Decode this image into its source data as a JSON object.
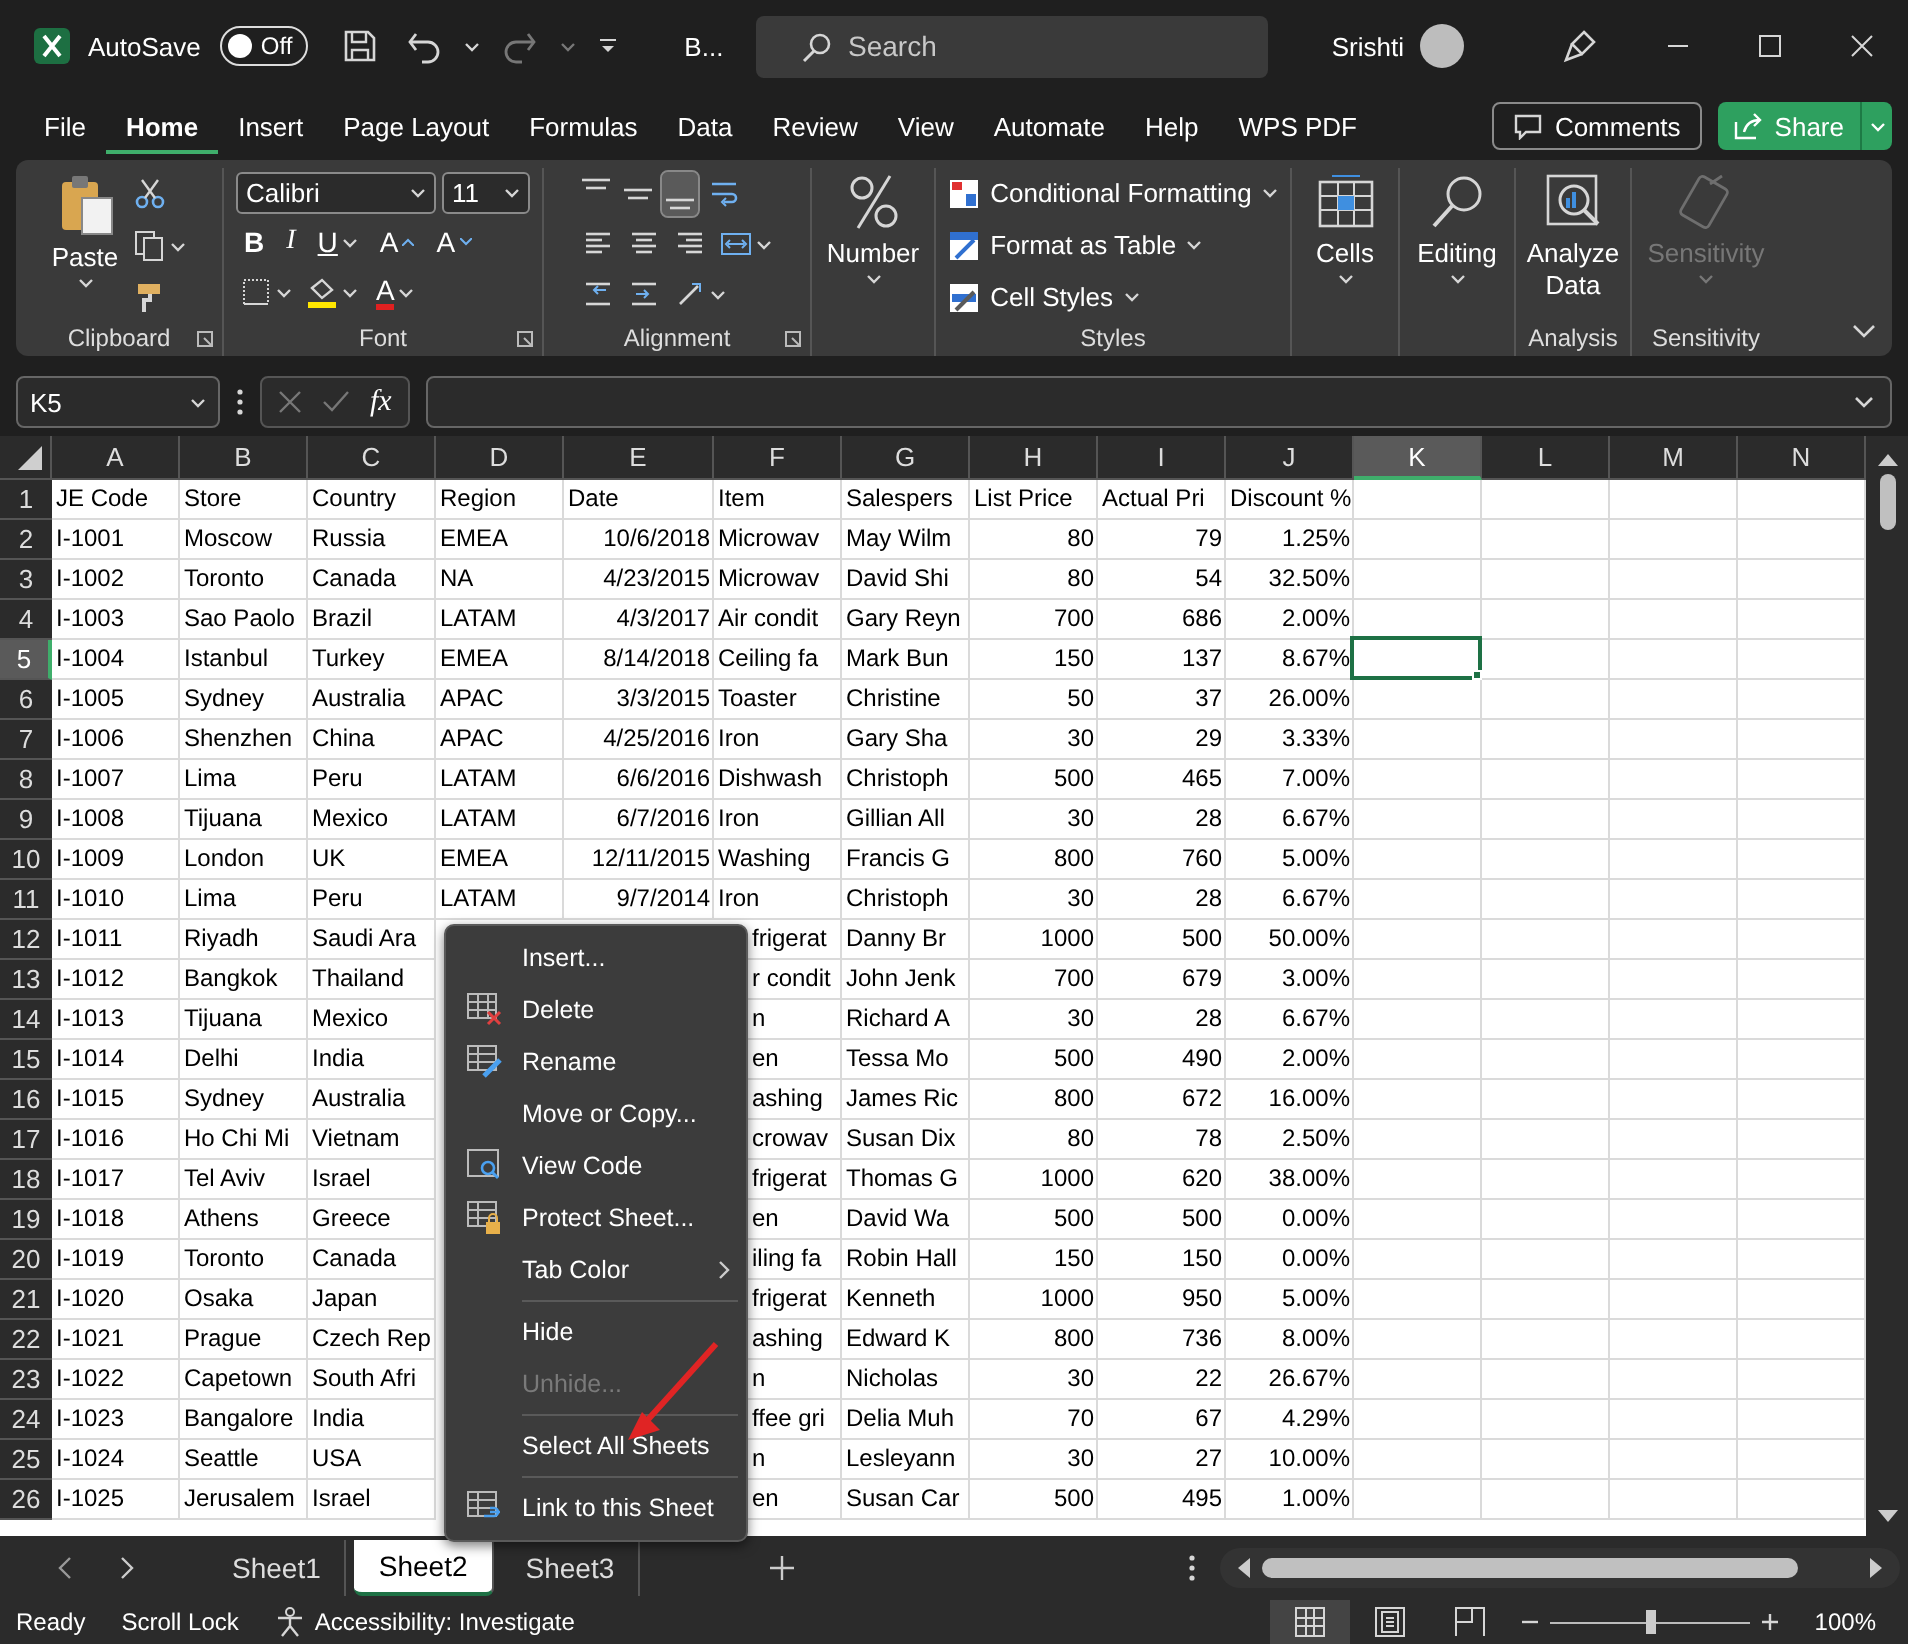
{
  "title_bar": {
    "autosave_label": "AutoSave",
    "autosave": {
      "on": false,
      "label": "Off"
    },
    "document_title": "B...",
    "search": {
      "placeholder": "Search"
    },
    "user": "Srishti"
  },
  "menu_tabs": [
    {
      "label": "File",
      "selected": false
    },
    {
      "label": "Home",
      "selected": true
    },
    {
      "label": "Insert",
      "selected": false
    },
    {
      "label": "Page Layout",
      "selected": false
    },
    {
      "label": "Formulas",
      "selected": false
    },
    {
      "label": "Data",
      "selected": false
    },
    {
      "label": "Review",
      "selected": false
    },
    {
      "label": "View",
      "selected": false
    },
    {
      "label": "Automate",
      "selected": false
    },
    {
      "label": "Help",
      "selected": false
    },
    {
      "label": "WPS PDF",
      "selected": false
    }
  ],
  "comments_button": "Comments",
  "share_button": "Share",
  "ribbon": {
    "groups": [
      {
        "kind": "clipboard",
        "label": "Clipboard",
        "button": "Paste",
        "launcher": true
      },
      {
        "kind": "font",
        "label": "Font",
        "font_name": "Calibri",
        "font_size": "11",
        "format_buttons": [
          "B",
          "I",
          "U"
        ],
        "size_buttons": [
          "A",
          "A"
        ],
        "font_color_button": "A",
        "launcher": true
      },
      {
        "kind": "alignment",
        "label": "Alignment",
        "launcher": true
      },
      {
        "kind": "number",
        "button": "Number"
      },
      {
        "kind": "styles",
        "label": "Styles",
        "buttons": [
          "Conditional Formatting",
          "Format as Table",
          "Cell Styles"
        ]
      },
      {
        "kind": "cells",
        "button": "Cells"
      },
      {
        "kind": "editing",
        "button": "Editing"
      },
      {
        "kind": "analysis",
        "label": "Analysis",
        "button": "Analyze Data"
      },
      {
        "kind": "sensitivity",
        "label": "Sensitivity",
        "button": "Sensitivity",
        "disabled": true
      }
    ]
  },
  "formula_bar": {
    "name_box": "K5",
    "function_button": "fx"
  },
  "sheet": {
    "columns": [
      {
        "label": "A",
        "kind": "text",
        "selected": false
      },
      {
        "label": "B",
        "kind": "text",
        "selected": false
      },
      {
        "label": "C",
        "kind": "text",
        "selected": false
      },
      {
        "label": "D",
        "kind": "text",
        "selected": false
      },
      {
        "label": "E",
        "kind": "number",
        "selected": false
      },
      {
        "label": "F",
        "kind": "text",
        "selected": false
      },
      {
        "label": "G",
        "kind": "text",
        "selected": false
      },
      {
        "label": "H",
        "kind": "number",
        "selected": false
      },
      {
        "label": "I",
        "kind": "number",
        "selected": false
      },
      {
        "label": "J",
        "kind": "number",
        "selected": false
      },
      {
        "label": "K",
        "kind": "text",
        "selected": true
      },
      {
        "label": "L",
        "kind": "text",
        "selected": false
      },
      {
        "label": "M",
        "kind": "text",
        "selected": false
      },
      {
        "label": "N",
        "kind": "text",
        "selected": false
      }
    ],
    "rows": [
      {
        "number": "1",
        "kind": "header",
        "selected": false,
        "cells": [
          "JE Code",
          "Store",
          "Country",
          "Region",
          "Date",
          "Item",
          "Salespers",
          "List Price",
          "Actual Pri",
          "Discount %"
        ]
      },
      {
        "number": "2",
        "kind": "data",
        "selected": false,
        "cells": [
          "I-1001",
          "Moscow",
          "Russia",
          "EMEA",
          "10/6/2018",
          "Microwav",
          "May Wilm",
          "80",
          "79",
          "1.25%"
        ]
      },
      {
        "number": "3",
        "kind": "data",
        "selected": false,
        "cells": [
          "I-1002",
          "Toronto",
          "Canada",
          "NA",
          "4/23/2015",
          "Microwav",
          "David Shi",
          "80",
          "54",
          "32.50%"
        ]
      },
      {
        "number": "4",
        "kind": "data",
        "selected": false,
        "cells": [
          "I-1003",
          "Sao Paolo",
          "Brazil",
          "LATAM",
          "4/3/2017",
          "Air condit",
          "Gary Reyn",
          "700",
          "686",
          "2.00%"
        ]
      },
      {
        "number": "5",
        "kind": "data",
        "selected": true,
        "cells": [
          "I-1004",
          "Istanbul",
          "Turkey",
          "EMEA",
          "8/14/2018",
          "Ceiling fa",
          "Mark Bun",
          "150",
          "137",
          "8.67%"
        ]
      },
      {
        "number": "6",
        "kind": "data",
        "selected": false,
        "cells": [
          "I-1005",
          "Sydney",
          "Australia",
          "APAC",
          "3/3/2015",
          "Toaster",
          "Christine",
          "50",
          "37",
          "26.00%"
        ]
      },
      {
        "number": "7",
        "kind": "data",
        "selected": false,
        "cells": [
          "I-1006",
          "Shenzhen",
          "China",
          "APAC",
          "4/25/2016",
          "Iron",
          "Gary Sha",
          "30",
          "29",
          "3.33%"
        ]
      },
      {
        "number": "8",
        "kind": "data",
        "selected": false,
        "cells": [
          "I-1007",
          "Lima",
          "Peru",
          "LATAM",
          "6/6/2016",
          "Dishwash",
          "Christoph",
          "500",
          "465",
          "7.00%"
        ]
      },
      {
        "number": "9",
        "kind": "data",
        "selected": false,
        "cells": [
          "I-1008",
          "Tijuana",
          "Mexico",
          "LATAM",
          "6/7/2016",
          "Iron",
          "Gillian All",
          "30",
          "28",
          "6.67%"
        ]
      },
      {
        "number": "10",
        "kind": "data",
        "selected": false,
        "cells": [
          "I-1009",
          "London",
          "UK",
          "EMEA",
          "12/11/2015",
          "Washing",
          "Francis G",
          "800",
          "760",
          "5.00%"
        ]
      },
      {
        "number": "11",
        "kind": "data",
        "selected": false,
        "cells": [
          "I-1010",
          "Lima",
          "Peru",
          "LATAM",
          "9/7/2014",
          "Iron",
          "Christoph",
          "30",
          "28",
          "6.67%"
        ]
      },
      {
        "number": "12",
        "kind": "data",
        "selected": false,
        "cells": [
          "I-1011",
          "Riyadh",
          "Saudi Ara",
          null,
          null,
          {
            "text": "frigerat",
            "partial": true
          },
          "Danny Br",
          "1000",
          "500",
          "50.00%"
        ]
      },
      {
        "number": "13",
        "kind": "data",
        "selected": false,
        "cells": [
          "I-1012",
          "Bangkok",
          "Thailand",
          null,
          null,
          {
            "text": "r condit",
            "partial": true
          },
          "John Jenk",
          "700",
          "679",
          "3.00%"
        ]
      },
      {
        "number": "14",
        "kind": "data",
        "selected": false,
        "cells": [
          "I-1013",
          "Tijuana",
          "Mexico",
          null,
          null,
          {
            "text": "n",
            "partial": true
          },
          "Richard A",
          "30",
          "28",
          "6.67%"
        ]
      },
      {
        "number": "15",
        "kind": "data",
        "selected": false,
        "cells": [
          "I-1014",
          "Delhi",
          "India",
          null,
          null,
          {
            "text": "en",
            "partial": true
          },
          "Tessa Mo",
          "500",
          "490",
          "2.00%"
        ]
      },
      {
        "number": "16",
        "kind": "data",
        "selected": false,
        "cells": [
          "I-1015",
          "Sydney",
          "Australia",
          null,
          null,
          {
            "text": "ashing",
            "partial": true
          },
          "James Ric",
          "800",
          "672",
          "16.00%"
        ]
      },
      {
        "number": "17",
        "kind": "data",
        "selected": false,
        "cells": [
          "I-1016",
          "Ho Chi Mi",
          "Vietnam",
          null,
          null,
          {
            "text": "crowav",
            "partial": true
          },
          "Susan Dix",
          "80",
          "78",
          "2.50%"
        ]
      },
      {
        "number": "18",
        "kind": "data",
        "selected": false,
        "cells": [
          "I-1017",
          "Tel Aviv",
          "Israel",
          null,
          null,
          {
            "text": "frigerat",
            "partial": true
          },
          "Thomas G",
          "1000",
          "620",
          "38.00%"
        ]
      },
      {
        "number": "19",
        "kind": "data",
        "selected": false,
        "cells": [
          "I-1018",
          "Athens",
          "Greece",
          null,
          null,
          {
            "text": "en",
            "partial": true
          },
          "David Wa",
          "500",
          "500",
          "0.00%"
        ]
      },
      {
        "number": "20",
        "kind": "data",
        "selected": false,
        "cells": [
          "I-1019",
          "Toronto",
          "Canada",
          null,
          null,
          {
            "text": "iling fa",
            "partial": true
          },
          "Robin Hall",
          "150",
          "150",
          "0.00%"
        ]
      },
      {
        "number": "21",
        "kind": "data",
        "selected": false,
        "cells": [
          "I-1020",
          "Osaka",
          "Japan",
          null,
          null,
          {
            "text": "frigerat",
            "partial": true
          },
          "Kenneth",
          "1000",
          "950",
          "5.00%"
        ]
      },
      {
        "number": "22",
        "kind": "data",
        "selected": false,
        "cells": [
          "I-1021",
          "Prague",
          "Czech Rep",
          null,
          null,
          {
            "text": "ashing",
            "partial": true
          },
          "Edward K",
          "800",
          "736",
          "8.00%"
        ]
      },
      {
        "number": "23",
        "kind": "data",
        "selected": false,
        "cells": [
          "I-1022",
          "Capetown",
          "South Afri",
          null,
          null,
          {
            "text": "n",
            "partial": true
          },
          "Nicholas",
          "30",
          "22",
          "26.67%"
        ]
      },
      {
        "number": "24",
        "kind": "data",
        "selected": false,
        "cells": [
          "I-1023",
          "Bangalore",
          "India",
          null,
          null,
          {
            "text": "ffee gri",
            "partial": true
          },
          "Delia Muh",
          "70",
          "67",
          "4.29%"
        ]
      },
      {
        "number": "25",
        "kind": "data",
        "selected": false,
        "cells": [
          "I-1024",
          "Seattle",
          "USA",
          null,
          null,
          {
            "text": "n",
            "partial": true
          },
          "Lesleyann",
          "30",
          "27",
          "10.00%"
        ]
      },
      {
        "number": "26",
        "kind": "data",
        "selected": false,
        "cells": [
          "I-1025",
          "Jerusalem",
          "Israel",
          null,
          null,
          {
            "text": "en",
            "partial": true
          },
          "Susan Car",
          "500",
          "495",
          "1.00%"
        ]
      }
    ]
  },
  "context_menu": {
    "items": [
      {
        "kind": "item",
        "label": "Insert...",
        "disabled": false,
        "submenu": false
      },
      {
        "kind": "item",
        "label": "Delete",
        "disabled": false,
        "submenu": false
      },
      {
        "kind": "item",
        "label": "Rename",
        "disabled": false,
        "submenu": false
      },
      {
        "kind": "item",
        "label": "Move or Copy...",
        "disabled": false,
        "submenu": false
      },
      {
        "kind": "item",
        "label": "View Code",
        "disabled": false,
        "submenu": false
      },
      {
        "kind": "item",
        "label": "Protect Sheet...",
        "disabled": false,
        "submenu": false
      },
      {
        "kind": "item",
        "label": "Tab Color",
        "disabled": false,
        "submenu": true
      },
      {
        "kind": "separator"
      },
      {
        "kind": "item",
        "label": "Hide",
        "disabled": false,
        "submenu": false
      },
      {
        "kind": "item",
        "label": "Unhide...",
        "disabled": true,
        "submenu": false
      },
      {
        "kind": "separator"
      },
      {
        "kind": "item",
        "label": "Select All Sheets",
        "disabled": false,
        "submenu": false
      },
      {
        "kind": "separator"
      },
      {
        "kind": "item",
        "label": "Link to this Sheet",
        "disabled": false,
        "submenu": false
      }
    ]
  },
  "sheet_tabs": [
    {
      "label": "Sheet1",
      "selected": false
    },
    {
      "label": "Sheet2",
      "selected": true
    },
    {
      "label": "Sheet3",
      "selected": false
    }
  ],
  "status_bar": {
    "items": [
      "Ready",
      "Scroll Lock"
    ],
    "accessibility": "Accessibility: Investigate",
    "views": [
      {
        "selected": true
      },
      {
        "selected": false
      },
      {
        "selected": false
      }
    ],
    "zoom": {
      "level": 0.5,
      "reading": "100%"
    }
  }
}
